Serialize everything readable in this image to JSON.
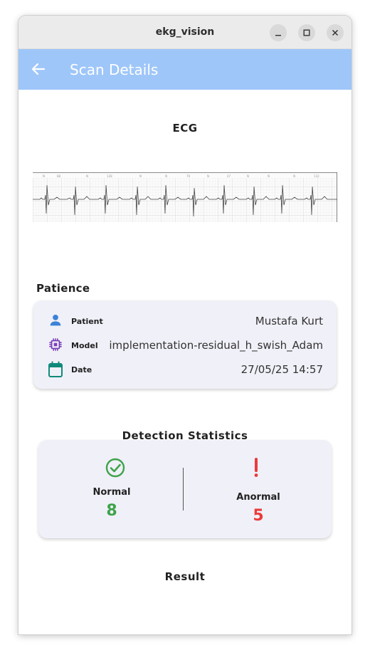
{
  "window": {
    "title": "ekg_vision",
    "controls": [
      "minimize-icon",
      "maximize-icon",
      "close-icon"
    ]
  },
  "appbar": {
    "back_icon": "arrow-left-icon",
    "title": "Scan Details",
    "color": "#9ec6f9"
  },
  "ecg": {
    "title": "ECG"
  },
  "patience": {
    "label": "Patience",
    "rows": [
      {
        "icon": "person-icon",
        "label": "Patient",
        "value": "Mustafa Kurt",
        "icon_color": "#3b82d6"
      },
      {
        "icon": "chip-icon",
        "label": "Model",
        "value": "implementation-residual_h_swish_Adam",
        "icon_color": "#7b3fb8"
      },
      {
        "icon": "calendar-icon",
        "label": "Date",
        "value": "27/05/25   14:57",
        "icon_color": "#0f8a7a"
      }
    ]
  },
  "stats": {
    "title": "Detection Statistics",
    "normal": {
      "label": "Normal",
      "count": "8",
      "icon": "check-circle-icon",
      "color": "#3ea34a"
    },
    "anormal": {
      "label": "Anormal",
      "count": "5",
      "icon": "exclamation-icon",
      "color": "#ea3b3b"
    }
  },
  "result": {
    "title": "Result"
  }
}
